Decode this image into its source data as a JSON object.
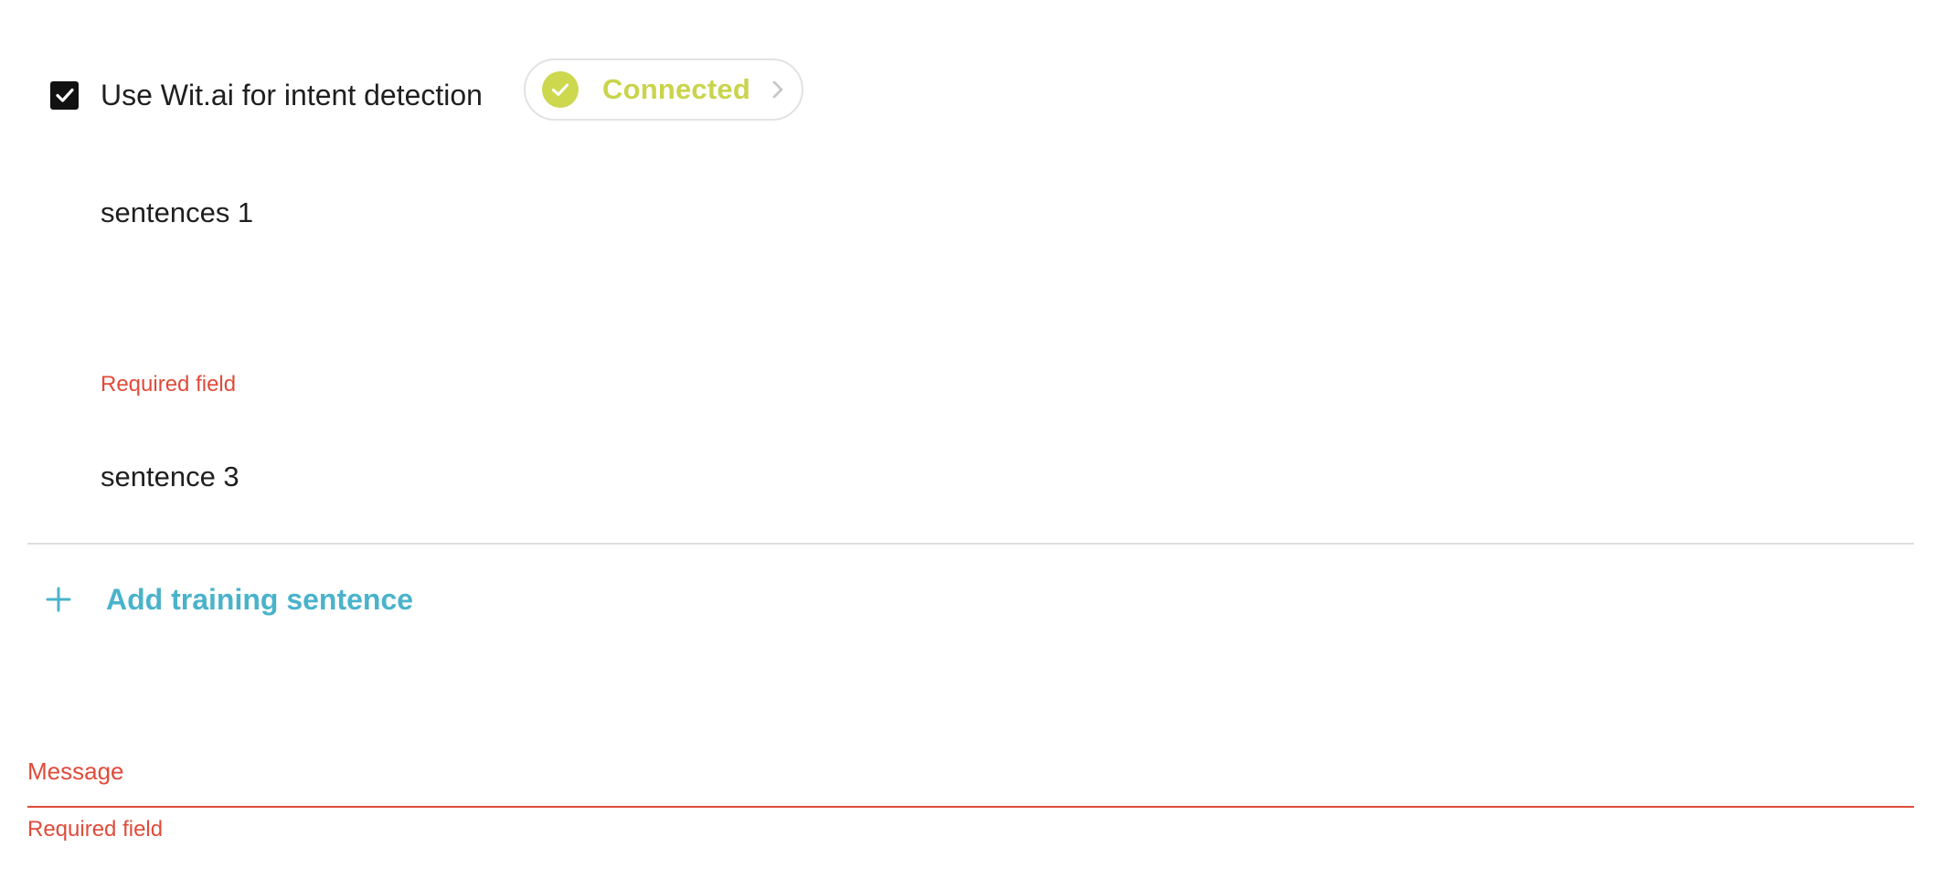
{
  "wit": {
    "checkbox_label": "Use Wit.ai for intent detection",
    "checked": true,
    "status_label": "Connected",
    "status_icon": "check-circle-icon",
    "status_chevron_icon": "chevron-right-icon"
  },
  "training": {
    "sentences": [
      {
        "value": "sentences 1",
        "error": ""
      },
      {
        "value": "",
        "error": "Required field"
      },
      {
        "value": "sentence 3",
        "error": ""
      }
    ],
    "add_label": "Add training sentence",
    "add_icon": "plus-icon"
  },
  "message": {
    "label": "Message",
    "value": "",
    "error": "Required field"
  },
  "colors": {
    "connected_accent": "#cdd84f",
    "link_accent": "#4ab3cb",
    "error": "#e04b3a",
    "divider": "#dddddd"
  }
}
